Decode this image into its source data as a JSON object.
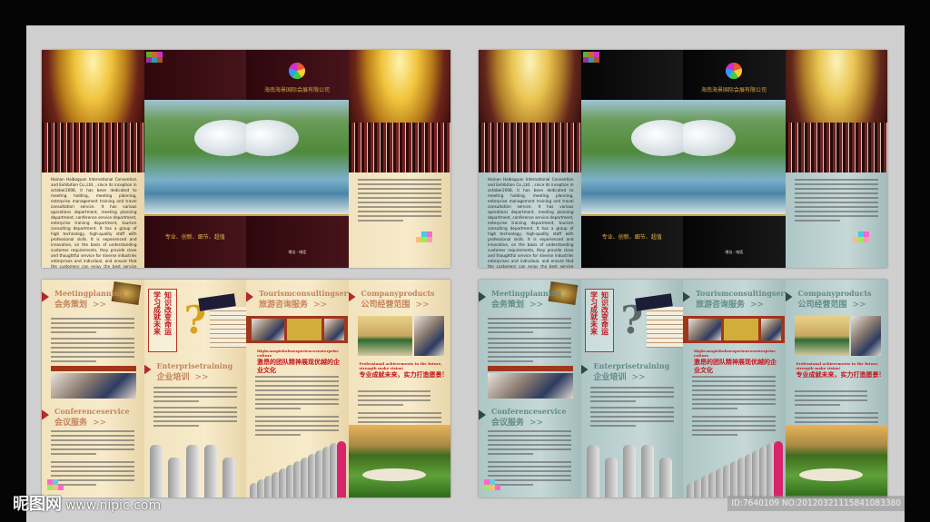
{
  "watermark": {
    "site_cn": "昵图网",
    "url": "www.nipic.com",
    "id_text": "ID:7640109 NO:20120321115841083380"
  },
  "cover": {
    "company_cn": "海南海景国际会展有限公司",
    "slogan": "专业、创新、细节、超值",
    "contact": "地址 · 电话"
  },
  "intro_en": "Hainan Haiboguan International Convention and Exhibition Co.,Ltd. , since its inception in october2008, it has been dedicated to meeting holding, meeting planning, enterprise management training and travel consultation service. It has various operations department, meeting planning department, conference service department, enterprise training department, tourism consulting department. It has a group of high technology, high-quality staff with professional skills. It is experienced and innovative, on the basis of understanding customer requirements, they provide close and thoughtful service for diverse industries enterprises and individual, and ensure that the customers can enjoy the best service with the most reasonable price.",
  "sections": {
    "meeting": {
      "en": "Meetingplanning",
      "cn": "会务策划"
    },
    "training": {
      "en": "Enterprisetraining",
      "cn": "企业培训"
    },
    "conference": {
      "en": "Conferenceservice",
      "cn": "会议服务"
    },
    "tourism": {
      "en": "Tourismconsultingservice",
      "cn": "旅游咨询服务"
    },
    "products": {
      "en": "Companyproducts",
      "cn": "公司经营范围"
    }
  },
  "chevron": ">>",
  "motto": {
    "line1": "知识改变命运",
    "line2": "学习成就未来"
  },
  "culture": {
    "en": "Highcanspiritalsoexperiencesenterprise culture",
    "cn": "激昂的团队精神展现优越的企业文化"
  },
  "vision": {
    "en": "Professional achievements in the future, strength make vision!",
    "cn": "专业成就未来，实力打造愿景!"
  },
  "themes": [
    "warm",
    "cool"
  ]
}
